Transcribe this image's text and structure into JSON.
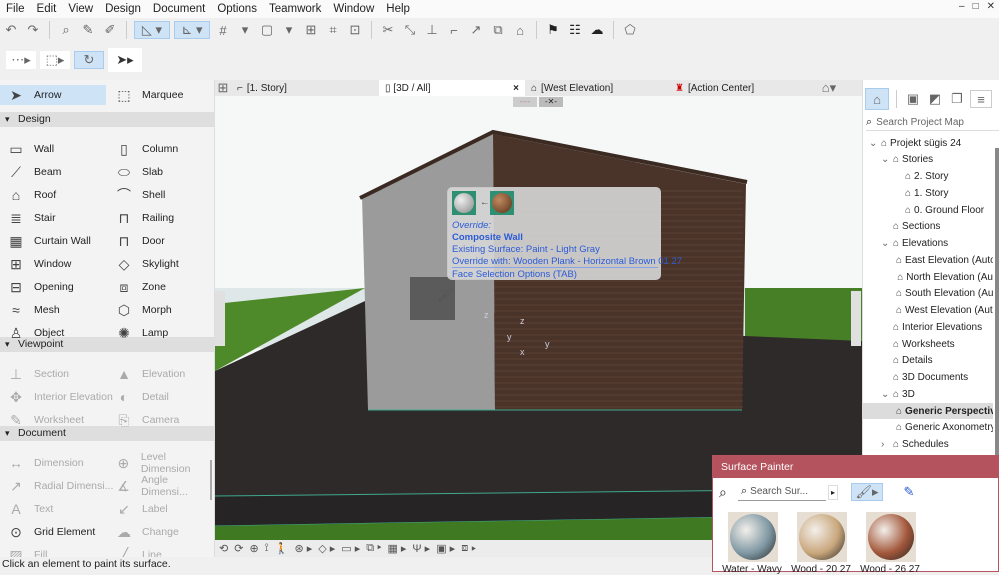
{
  "menu": [
    "File",
    "Edit",
    "View",
    "Design",
    "Document",
    "Options",
    "Teamwork",
    "Window",
    "Help"
  ],
  "window_controls": [
    "–",
    "□",
    "✕"
  ],
  "palette": {
    "arrow": "Arrow",
    "marquee": "Marquee",
    "design_header": "Design",
    "design_items": [
      [
        "Wall",
        "Column"
      ],
      [
        "Beam",
        "Slab"
      ],
      [
        "Roof",
        "Shell"
      ],
      [
        "Stair",
        "Railing"
      ],
      [
        "Curtain Wall",
        "Door"
      ],
      [
        "Window",
        "Skylight"
      ],
      [
        "Opening",
        "Zone"
      ],
      [
        "Mesh",
        "Morph"
      ],
      [
        "Object",
        "Lamp"
      ]
    ],
    "viewpoint_header": "Viewpoint",
    "viewpoint_items": [
      [
        "Section",
        "Elevation"
      ],
      [
        "Interior Elevation",
        "Detail"
      ],
      [
        "Worksheet",
        "Camera"
      ]
    ],
    "document_header": "Document",
    "document_items": [
      [
        "Dimension",
        "Level Dimension"
      ],
      [
        "Radial Dimensi...",
        "Angle Dimensi..."
      ],
      [
        "Text",
        "Label"
      ],
      [
        "Grid Element",
        "Change"
      ],
      [
        "Fill",
        "Line"
      ]
    ]
  },
  "tabs": [
    {
      "label": "[1. Story]"
    },
    {
      "label": "[3D / All]",
      "active": true,
      "close": "×"
    },
    {
      "label": "[West Elevation]"
    },
    {
      "label": "[Action Center]"
    }
  ],
  "tooltip": {
    "header": "Override:",
    "element": "Composite Wall",
    "existing": "Existing Surface: Paint - Light Gray",
    "override": "Override with: Wooden Plank - Horizontal Brown 01 27",
    "footer": "Face Selection Options (TAB)"
  },
  "axes": {
    "z": "z",
    "y": "y",
    "x": "x"
  },
  "status": "Click an element to paint its surface.",
  "navigator": {
    "search_placeholder": "Search Project Map",
    "tree": [
      {
        "label": "Projekt sügis 24",
        "level": 0,
        "exp": "v"
      },
      {
        "label": "Stories",
        "level": 1,
        "exp": "v"
      },
      {
        "label": "2. Story",
        "level": 2
      },
      {
        "label": "1. Story",
        "level": 2
      },
      {
        "label": "0. Ground Floor",
        "level": 2
      },
      {
        "label": "Sections",
        "level": 1
      },
      {
        "label": "Elevations",
        "level": 1,
        "exp": "v"
      },
      {
        "label": "East Elevation (Auto",
        "level": 2
      },
      {
        "label": "North Elevation (Au",
        "level": 2
      },
      {
        "label": "South Elevation (Au",
        "level": 2
      },
      {
        "label": "West Elevation (Auto",
        "level": 2
      },
      {
        "label": "Interior Elevations",
        "level": 1
      },
      {
        "label": "Worksheets",
        "level": 1
      },
      {
        "label": "Details",
        "level": 1
      },
      {
        "label": "3D Documents",
        "level": 1
      },
      {
        "label": "3D",
        "level": 1,
        "exp": "v"
      },
      {
        "label": "Generic Perspective",
        "level": 2,
        "selected": true
      },
      {
        "label": "Generic Axonometry",
        "level": 2
      },
      {
        "label": "Schedules",
        "level": 1,
        "exp": ">"
      }
    ]
  },
  "surface_painter": {
    "title": "Surface Painter",
    "search_placeholder": "Search Sur...",
    "surfaces": [
      {
        "label": "Water - Wavy",
        "color": "#7f98a3"
      },
      {
        "label": "Wood - 20 27",
        "color": "#c9a77c"
      },
      {
        "label": "Wood - 26 27",
        "color": "#a2573a"
      }
    ]
  },
  "colors": {
    "accent": "#2a5bd7",
    "painter_header": "#b4525d",
    "selection": "#cfe3f6"
  }
}
